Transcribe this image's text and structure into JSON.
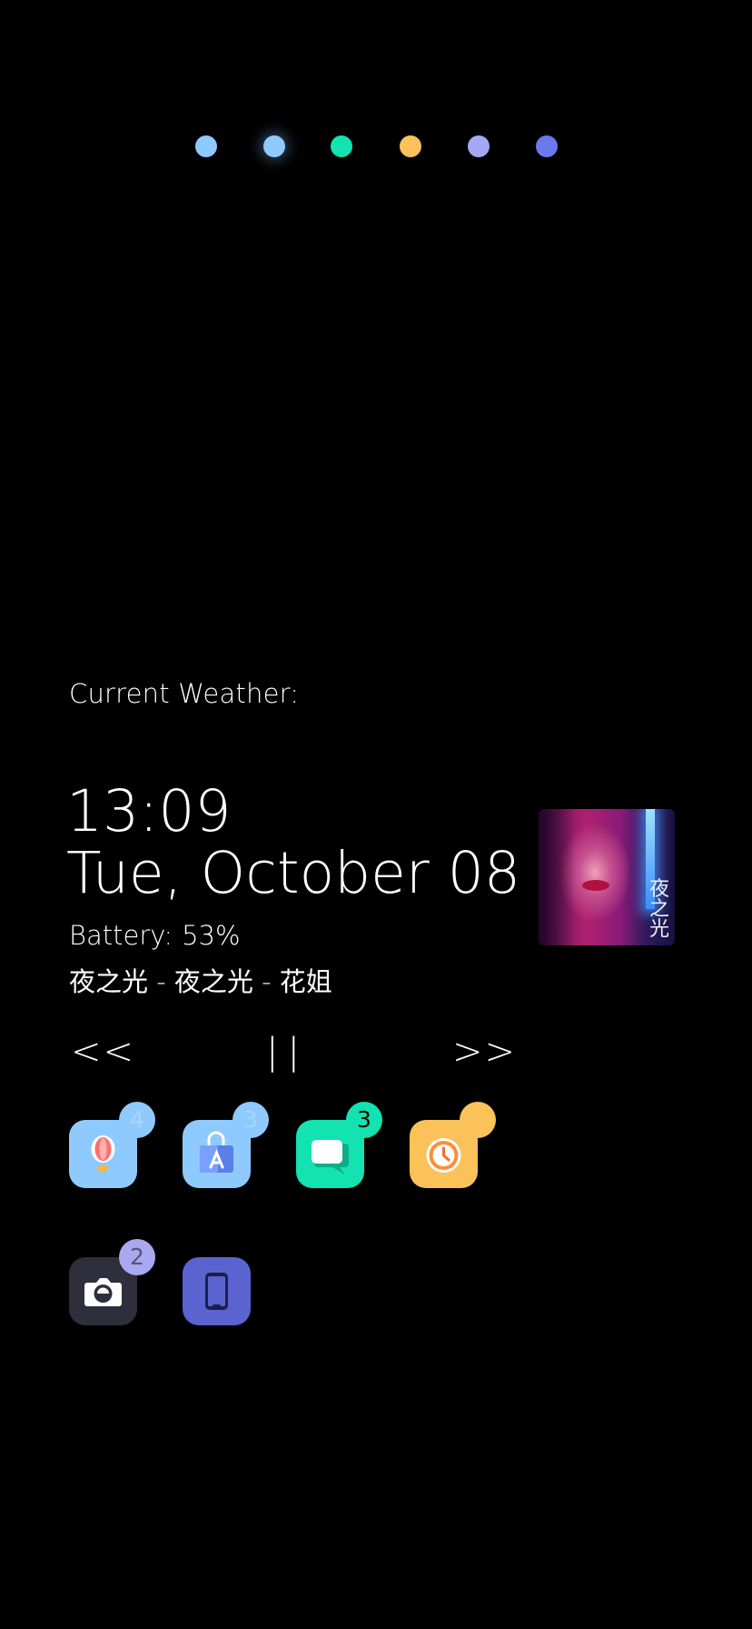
{
  "page_dots": [
    {
      "color": "#8ec9ff",
      "glow": false
    },
    {
      "color": "#8ec9ff",
      "glow": true
    },
    {
      "color": "#12e3b0",
      "glow": false
    },
    {
      "color": "#fcc25a",
      "glow": false
    },
    {
      "color": "#a7a8f5",
      "glow": false
    },
    {
      "color": "#6b78ee",
      "glow": false
    }
  ],
  "weather": {
    "label": "Current Weather:"
  },
  "clock": {
    "time": "13:09",
    "date": "Tue, October 08"
  },
  "battery": {
    "label": "Battery:",
    "value": "53%"
  },
  "now_playing": {
    "track_line": "夜之光 - 夜之光 - 花姐",
    "album_art_text": "夜之光"
  },
  "media_controls": {
    "prev_label": "<<",
    "pause_label": "||",
    "next_label": ">>"
  },
  "apps": [
    {
      "name": "balloon-app",
      "icon": "hot-air-balloon-icon",
      "color": "#8fcaff",
      "badge": "4",
      "badge_color": "#8fcaff",
      "badge_text_color": "#a9d6ff"
    },
    {
      "name": "app-store-app",
      "icon": "shopping-bag-icon",
      "color": "#8fcaff",
      "badge": "3",
      "badge_color": "#8fcaff",
      "badge_text_color": "#a9d6ff"
    },
    {
      "name": "messages-app",
      "icon": "chat-bubble-icon",
      "color": "#12e3b0",
      "badge": "3",
      "badge_color": "#12e3b0",
      "badge_text_color": "#000000"
    },
    {
      "name": "clock-app",
      "icon": "clock-icon",
      "color": "#fcc25a",
      "badge": "",
      "badge_color": "#fcc25a",
      "badge_text_color": "#000000"
    },
    {
      "name": "camera-app",
      "icon": "camera-icon",
      "color": "#2e2e3c",
      "badge": "2",
      "badge_color": "#aaa8f0",
      "badge_text_color": "#555577"
    },
    {
      "name": "phone-app",
      "icon": "phone-device-icon",
      "color": "#5a63cf",
      "badge": "",
      "badge_color": "",
      "badge_text_color": ""
    }
  ]
}
